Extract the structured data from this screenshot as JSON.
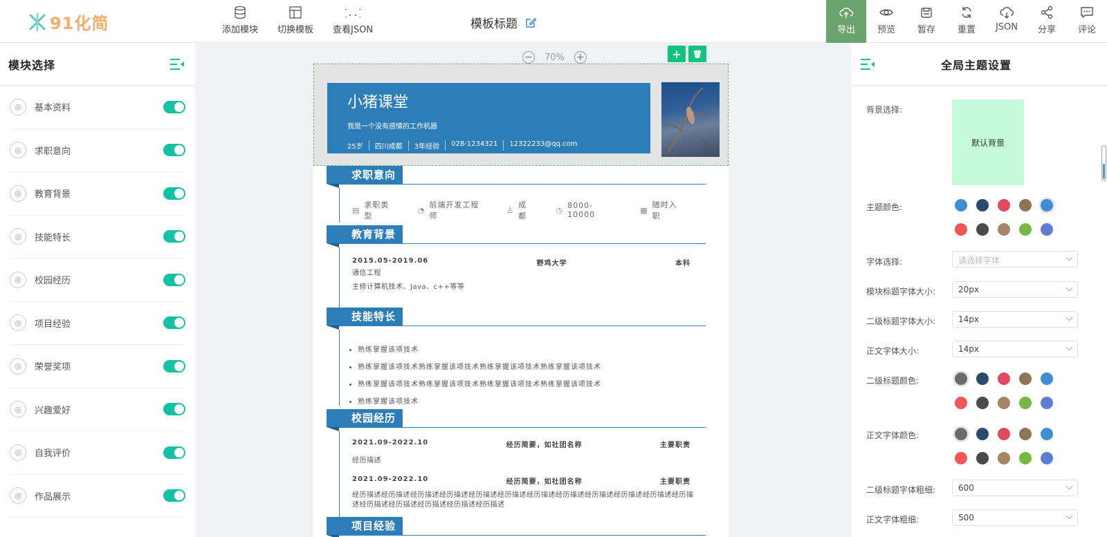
{
  "brand": {
    "logo_text": "91化简"
  },
  "toolbar": {
    "add_module": "添加模块",
    "switch_template": "切换模板",
    "view_json": "查看JSON"
  },
  "template_title": "模板标题",
  "actions": [
    {
      "label": "导出",
      "icon": "cloud-upload-icon"
    },
    {
      "label": "预览",
      "icon": "eye-icon"
    },
    {
      "label": "暂存",
      "icon": "save-icon"
    },
    {
      "label": "重置",
      "icon": "refresh-icon"
    },
    {
      "label": "JSON",
      "icon": "cloud-download-icon"
    },
    {
      "label": "分享",
      "icon": "share-icon"
    },
    {
      "label": "评论",
      "icon": "comment-icon"
    }
  ],
  "left_panel": {
    "title": "模块选择",
    "items": [
      {
        "label": "基本资料",
        "enabled": true
      },
      {
        "label": "求职意向",
        "enabled": true
      },
      {
        "label": "教育背景",
        "enabled": true
      },
      {
        "label": "技能特长",
        "enabled": true
      },
      {
        "label": "校园经历",
        "enabled": true
      },
      {
        "label": "项目经验",
        "enabled": true
      },
      {
        "label": "荣誉奖项",
        "enabled": true
      },
      {
        "label": "兴趣爱好",
        "enabled": true
      },
      {
        "label": "自我评价",
        "enabled": true
      },
      {
        "label": "作品展示",
        "enabled": true
      }
    ]
  },
  "canvas": {
    "zoom_minus": "−",
    "zoom_value": "70%",
    "zoom_plus": "+",
    "add_btn": "+",
    "delete_btn": "🗑"
  },
  "resume": {
    "name": "小猪课堂",
    "motto": "我是一个没有感情的工作机器",
    "info": [
      "25岁",
      "四川成都",
      "3年经验",
      "028-1234321",
      "12322233@qq.com"
    ],
    "sections": {
      "intent": {
        "title": "求职意向",
        "items": [
          "求职类型",
          "前端开发工程师",
          "成都",
          "8000-10000",
          "随时入职"
        ]
      },
      "education": {
        "title": "教育背景",
        "date": "2015.05-2019.06",
        "school": "野鸡大学",
        "degree": "本科",
        "major": "通信工程",
        "courses": "主修计算机技术、Java、c++等等"
      },
      "skills": {
        "title": "技能特长",
        "items": [
          "熟练掌握该项技术",
          "熟练掌握该项技术熟练掌握该项技术熟练掌握该项技术熟练掌握该项技术",
          "熟练掌握该项技术熟练掌握该项技术熟练掌握该项技术熟练掌握该项技术",
          "熟练掌握该项技术"
        ]
      },
      "campus": {
        "title": "校园经历",
        "entries": [
          {
            "date": "2021.09-2022.10",
            "summary": "经历简要，如社团名称",
            "role": "主要职责",
            "desc": "经历描述"
          },
          {
            "date": "2021.09-2022.10",
            "summary": "经历简要，如社团名称",
            "role": "主要职责",
            "desc": "经历描述经历描述经历描述经历描述经历描述经历描述经历描述经历描述经历描述经历描述经历描述经历描述经历描述经历描述经历描述经历描述经历描述"
          }
        ]
      },
      "project": {
        "title": "项目经验"
      }
    }
  },
  "right_panel": {
    "title": "全局主题设置",
    "bg_label": "背景选择:",
    "bg_default": "默认背景",
    "theme_color_label": "主题颜色:",
    "theme_colors": [
      "#3d8fd1",
      "#2c4a6e",
      "#e04a5e",
      "#8f7455",
      "#3d8fd1",
      "#f25555",
      "#4a4a4a",
      "#a48566",
      "#76b842",
      "#5c7ed1"
    ],
    "font_label": "字体选择:",
    "font_placeholder": "请选择字体",
    "module_title_size_label": "模块标题字体大小:",
    "module_title_size": "20px",
    "sub_title_size_label": "二级标题字体大小:",
    "sub_title_size": "14px",
    "body_size_label": "正文字体大小:",
    "body_size": "14px",
    "sub_title_color_label": "二级标题颜色:",
    "sub_title_colors": [
      "#6b6b6b",
      "#2c4a6e",
      "#e04a5e",
      "#8f7455",
      "#3d8fd1",
      "#f25555",
      "#4a4a4a",
      "#a48566",
      "#76b842",
      "#5c7ed1"
    ],
    "body_color_label": "正文字体颜色:",
    "body_colors": [
      "#6b6b6b",
      "#2c4a6e",
      "#e04a5e",
      "#8f7455",
      "#3d8fd1",
      "#f25555",
      "#4a4a4a",
      "#a48566",
      "#76b842",
      "#5c7ed1"
    ],
    "sub_title_weight_label": "二级标题字体粗细:",
    "sub_title_weight": "600",
    "body_weight_label": "正文字体粗细:",
    "body_weight": "500"
  }
}
